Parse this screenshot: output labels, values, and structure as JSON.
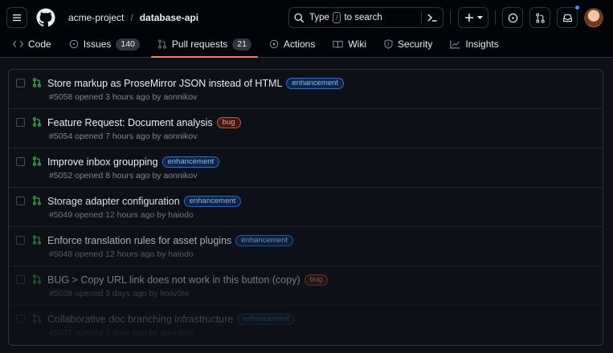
{
  "colors": {
    "accent": "#f78166",
    "open_pr": "#3fb950",
    "enhancement": "#79c0ff",
    "bug": "#ff9a7a"
  },
  "header": {
    "owner": "acme-project",
    "separator": "/",
    "repo": "database-api",
    "search": {
      "pre": "Type",
      "key": "/",
      "post": "to search"
    },
    "icons": [
      "menu-icon",
      "github-logo-icon",
      "search-icon",
      "command-palette-icon",
      "plus-icon",
      "chevron-down-icon",
      "issues-icon",
      "pull-request-icon",
      "inbox-icon",
      "avatar"
    ]
  },
  "tabs": [
    {
      "label": "Code",
      "icon": "code-icon"
    },
    {
      "label": "Issues",
      "icon": "issue-opened-icon",
      "count": "140"
    },
    {
      "label": "Pull requests",
      "icon": "git-pull-request-icon",
      "count": "21"
    },
    {
      "label": "Actions",
      "icon": "play-icon"
    },
    {
      "label": "Wiki",
      "icon": "book-icon"
    },
    {
      "label": "Security",
      "icon": "shield-icon"
    },
    {
      "label": "Insights",
      "icon": "graph-icon"
    }
  ],
  "pulls": [
    {
      "title": "Store markup as ProseMirror JSON instead of HTML",
      "label": "enhancement",
      "meta": "#5058 opened 3 hours ago by aonnikov"
    },
    {
      "title": "Feature Request: Document analysis",
      "label": "bug",
      "meta": "#5054 opened 7 hours ago by aonnikov"
    },
    {
      "title": "Improve inbox groupping",
      "label": "enhancement",
      "meta": "#5052 opened 8 hours ago by aonnikov"
    },
    {
      "title": "Storage adapter configuration",
      "label": "enhancement",
      "meta": "#5049 opened 12 hours ago by haiodo"
    },
    {
      "title": "Enforce translation rules for asset plugins",
      "label": "enhancement",
      "meta": "#5048 opened 12 hours ago by haiodo"
    },
    {
      "title": "BUG > Copy URL link does not work in this button (copy)",
      "label": "bug",
      "meta": "#5038 opened 3 days ago by lexiv0re"
    },
    {
      "title": "Collaborative doc branching infrastructure",
      "label": "enhancement",
      "meta": "#5037 opened 3 days ago by aonnikov"
    }
  ]
}
